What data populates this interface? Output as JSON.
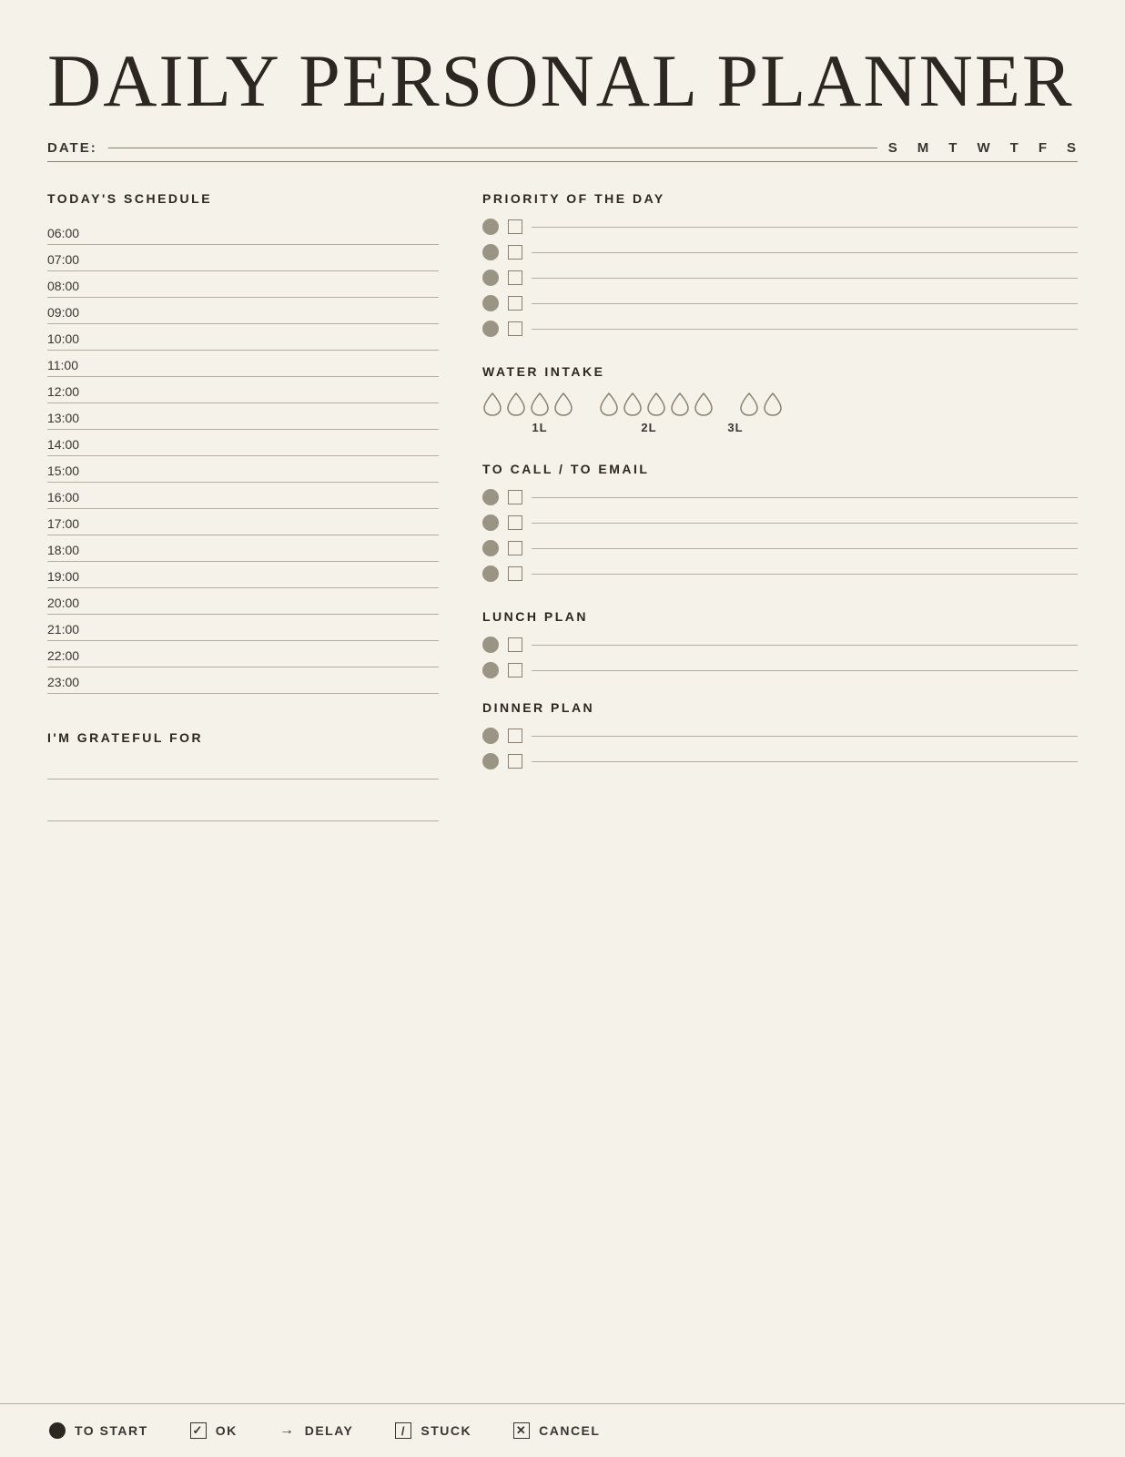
{
  "title": "DAILY PERSONAL PLANNER",
  "date": {
    "label": "DATE:",
    "days": [
      "S",
      "M",
      "T",
      "W",
      "T",
      "F",
      "S"
    ]
  },
  "schedule": {
    "title": "TODAY'S SCHEDULE",
    "times": [
      "06:00",
      "07:00",
      "08:00",
      "09:00",
      "10:00",
      "11:00",
      "12:00",
      "13:00",
      "14:00",
      "15:00",
      "16:00",
      "17:00",
      "18:00",
      "19:00",
      "20:00",
      "21:00",
      "22:00",
      "23:00"
    ]
  },
  "grateful": {
    "title": "I'M GRATEFUL FOR",
    "lines": 2
  },
  "priority": {
    "title": "PRIORITY OF THE DAY",
    "items": 5
  },
  "water": {
    "title": "WATER INTAKE",
    "labels": [
      "1L",
      "2L",
      "3L"
    ],
    "groups": [
      4,
      5,
      2
    ]
  },
  "call": {
    "title": "TO CALL / TO EMAIL",
    "items": 4
  },
  "lunch": {
    "title": "LUNCH PLAN",
    "items": 2
  },
  "dinner": {
    "title": "DINNER PLAN",
    "items": 2
  },
  "legend": {
    "items": [
      {
        "icon": "filled-circle",
        "label": "TO START"
      },
      {
        "icon": "checkmark-box",
        "label": "OK"
      },
      {
        "icon": "arrow",
        "label": "DELAY"
      },
      {
        "icon": "slash-box",
        "label": "STUCK"
      },
      {
        "icon": "x-box",
        "label": "CANCEL"
      }
    ]
  }
}
